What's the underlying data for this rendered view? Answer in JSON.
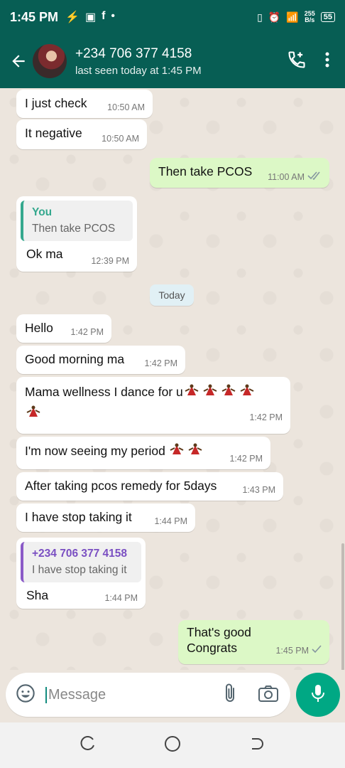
{
  "status_bar": {
    "time": "1:45 PM",
    "net_speed_value": "255",
    "net_speed_unit": "B/s",
    "battery": "55"
  },
  "header": {
    "contact_name": "+234 706 377 4158",
    "last_seen": "last seen today at 1:45 PM"
  },
  "messages": [
    {
      "direction": "in",
      "text": "I just check",
      "time": "10:50 AM"
    },
    {
      "direction": "in",
      "text": "It negative",
      "time": "10:50 AM"
    },
    {
      "direction": "out",
      "text": "Then take PCOS",
      "time": "11:00 AM",
      "status": "read"
    },
    {
      "direction": "in",
      "quote_author": "You",
      "quote_text": "Then take PCOS",
      "text": "Ok ma",
      "time": "12:39 PM"
    },
    {
      "direction": "in",
      "text": "Hello",
      "time": "1:42 PM"
    },
    {
      "direction": "in",
      "text": "Good morning ma",
      "time": "1:42 PM"
    },
    {
      "direction": "in",
      "text": "Mama wellness I dance for u",
      "emoji": "dancer-emoji ×5",
      "time": "1:42 PM"
    },
    {
      "direction": "in",
      "text": "I'm now seeing my period",
      "emoji": "dancer-emoji ×2",
      "time": "1:42 PM"
    },
    {
      "direction": "in",
      "text": "After taking pcos remedy for 5days",
      "time": "1:43 PM"
    },
    {
      "direction": "in",
      "text": "I have stop taking it",
      "time": "1:44 PM"
    },
    {
      "direction": "in",
      "quote_author": "+234 706 377 4158",
      "quote_text": "I have stop taking it",
      "text": "Sha",
      "time": "1:44 PM"
    },
    {
      "direction": "out",
      "text": "That's good",
      "text2": "Congrats",
      "time": "1:45 PM",
      "status": "sent"
    }
  ],
  "date_divider": "Today",
  "composer": {
    "placeholder": "Message"
  },
  "colors": {
    "header": "#075e54",
    "outgoing_bubble": "#dcf8c6",
    "mic_button": "#00a884",
    "read_tick": "#53bdeb"
  }
}
